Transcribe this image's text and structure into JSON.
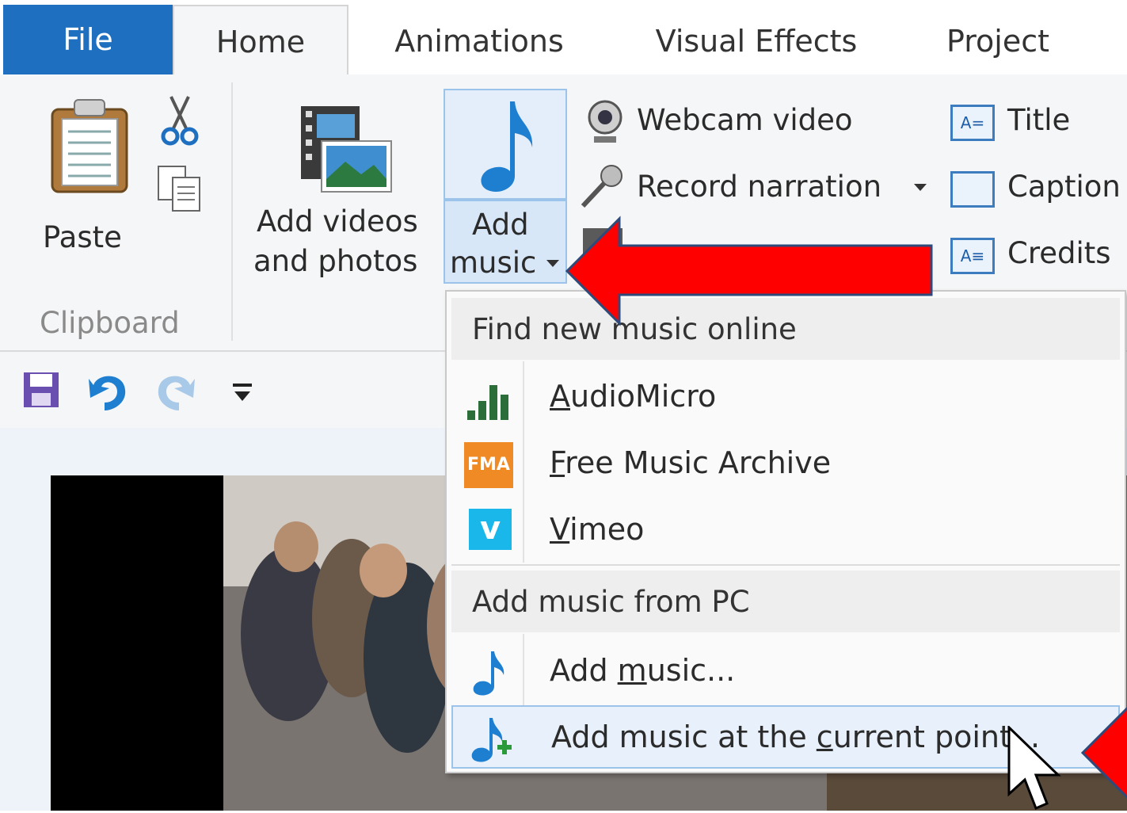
{
  "tabs": {
    "file": "File",
    "home": "Home",
    "animations": "Animations",
    "visual_effects": "Visual Effects",
    "project": "Project"
  },
  "ribbon": {
    "paste": "Paste",
    "clipboard_group": "Clipboard",
    "add_videos_line1": "Add videos",
    "add_videos_line2": "and photos",
    "add_music_line1": "Add",
    "add_music_line2": "music",
    "webcam_video": "Webcam video",
    "record_narration": "Record narration",
    "title": "Title",
    "caption": "Caption",
    "credits": "Credits"
  },
  "menu": {
    "online_header": "Find new music online",
    "online_items": [
      {
        "pre": "",
        "accel": "A",
        "post": "udioMicro",
        "icon": "audiomicro-icon"
      },
      {
        "pre": "",
        "accel": "F",
        "post": "ree Music Archive",
        "icon": "fma-icon",
        "icon_text": "FMA"
      },
      {
        "pre": "",
        "accel": "V",
        "post": "imeo",
        "icon": "vimeo-icon",
        "icon_text": "v"
      }
    ],
    "pc_header": "Add music from PC",
    "pc_items": [
      {
        "pre": "Add ",
        "accel": "m",
        "post": "usic...",
        "icon": "music-note-icon"
      },
      {
        "pre": "Add music at the ",
        "accel": "c",
        "post": "urrent point...",
        "icon": "music-add-icon"
      }
    ]
  },
  "colors": {
    "file_tab": "#1f6fc1",
    "annotation_arrow": "#ff0000",
    "arrow_outline": "#2e4a7a",
    "highlight": "#e8f1fb"
  }
}
